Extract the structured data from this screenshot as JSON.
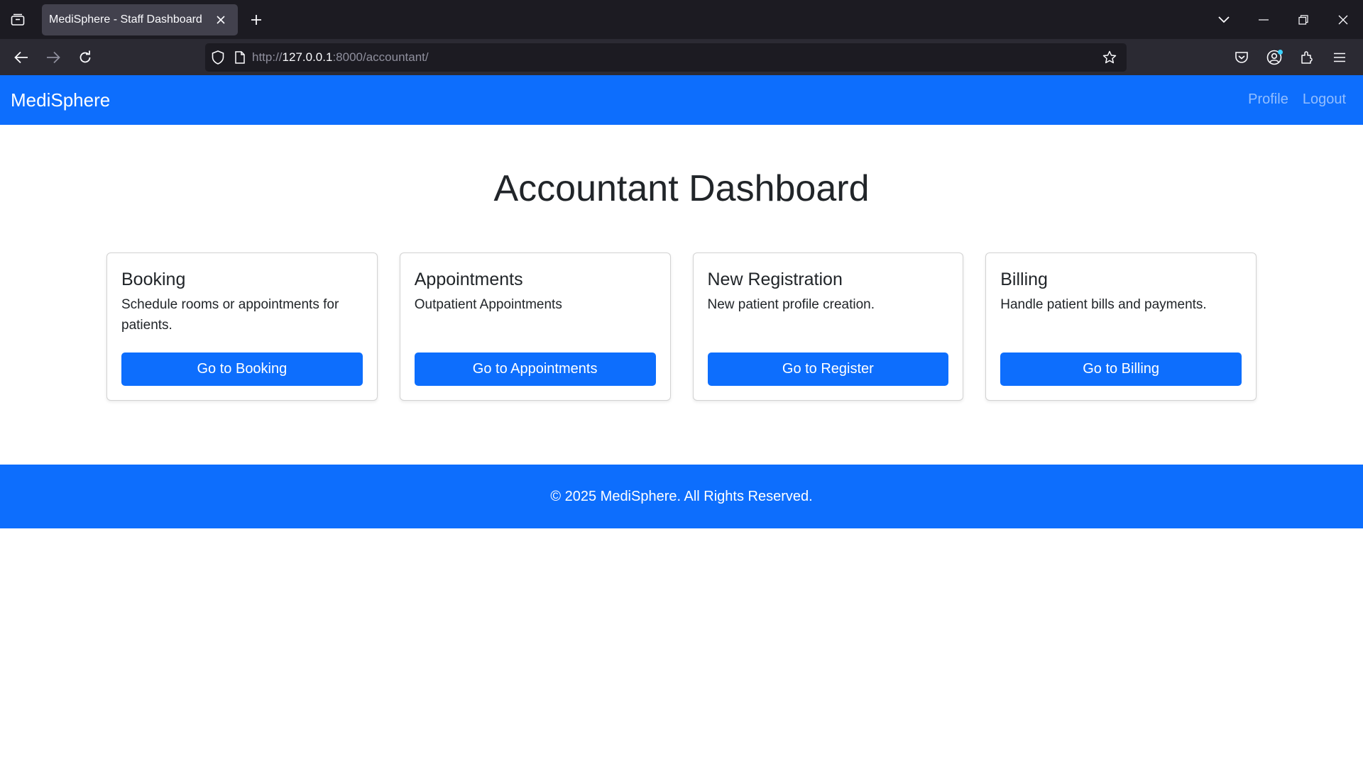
{
  "browser": {
    "tab_title": "MediSphere - Staff Dashboard",
    "url_prefix": "http://",
    "url_host": "127.0.0.1",
    "url_rest": ":8000/accountant/"
  },
  "site": {
    "brand": "MediSphere",
    "nav_links": [
      "Profile",
      "Logout"
    ]
  },
  "page": {
    "title": "Accountant Dashboard"
  },
  "cards": [
    {
      "title": "Booking",
      "text": "Schedule rooms or appointments for patients.",
      "button": "Go to Booking"
    },
    {
      "title": "Appointments",
      "text": "Outpatient Appointments",
      "button": "Go to Appointments"
    },
    {
      "title": "New Registration",
      "text": "New patient profile creation.",
      "button": "Go to Register"
    },
    {
      "title": "Billing",
      "text": "Handle patient bills and payments.",
      "button": "Go to Billing"
    }
  ],
  "footer": {
    "text": "© 2025 MediSphere. All Rights Reserved."
  },
  "colors": {
    "primary": "#0d6efd",
    "browser_tabbar": "#1c1b22",
    "browser_toolbar": "#2b2a33"
  }
}
